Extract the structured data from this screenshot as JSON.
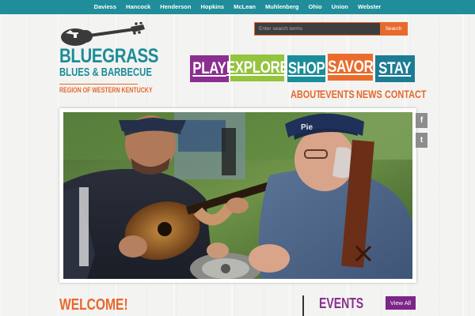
{
  "topbar": {
    "counties": [
      "Daviess",
      "Hancock",
      "Henderson",
      "Hopkins",
      "McLean",
      "Muhlenberg",
      "Ohio",
      "Union",
      "Webster"
    ]
  },
  "logo": {
    "line1": "BLUEGRASS",
    "line2": "BLUES & BARBECUE",
    "line3": "REGION OF WESTERN KENTUCKY"
  },
  "search": {
    "placeholder": "Enter search terms",
    "button_label": "Search"
  },
  "main_nav": [
    {
      "label": "PLAY",
      "color": "#8a2f8f"
    },
    {
      "label": "EXPLORE",
      "color": "#94c33d"
    },
    {
      "label": "SHOP",
      "color": "#1b8c99"
    },
    {
      "label": "SAVOR",
      "color": "#e96c2c"
    },
    {
      "label": "STAY",
      "color": "#1c7c94"
    }
  ],
  "sub_nav": [
    "ABOUT",
    "EVENTS",
    "NEWS",
    "CONTACT"
  ],
  "social": {
    "facebook_glyph": "f",
    "twitter_glyph": "t",
    "facebook_icon": "facebook-icon",
    "twitter_icon": "twitter-icon"
  },
  "hero": {
    "cap_text": "Pie"
  },
  "welcome": {
    "heading": "WELCOME!"
  },
  "events": {
    "heading": "EVENTS",
    "view_all_label": "View All"
  },
  "colors": {
    "teal": "#1f8d9a",
    "orange": "#e7682b",
    "purple": "#8a2f8f",
    "green": "#94c33d"
  }
}
